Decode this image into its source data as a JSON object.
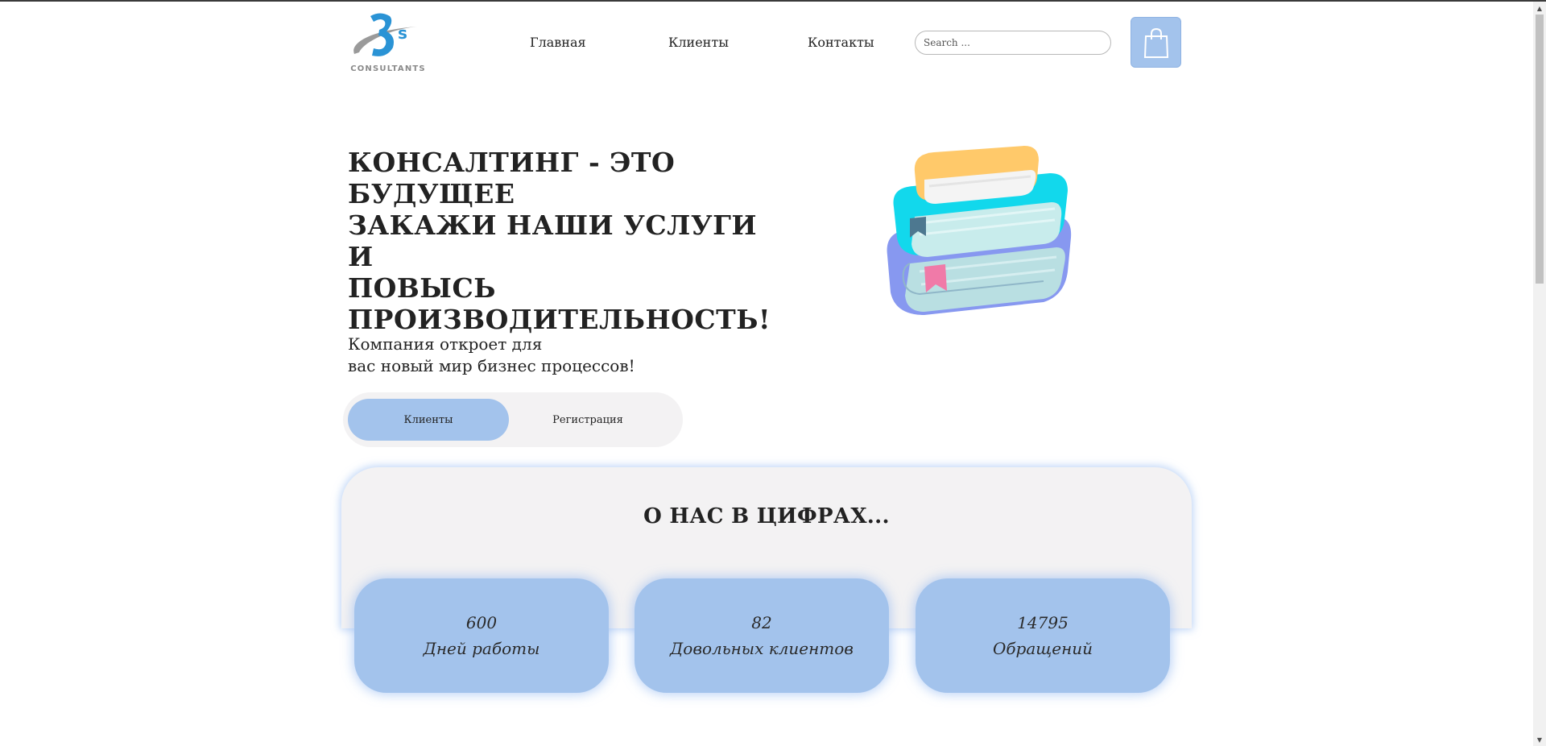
{
  "header": {
    "logo_text": "CONSULTANTS",
    "nav": [
      {
        "label": "Главная"
      },
      {
        "label": "Клиенты"
      },
      {
        "label": "Контакты"
      }
    ],
    "search_placeholder": "Search ...",
    "cart_icon": "shopping-bag-icon"
  },
  "hero": {
    "title_lines": [
      "КОНСАЛТИНГ - ЭТО",
      "БУДУЩЕЕ",
      "ЗАКАЖИ НАШИ УСЛУГИ И",
      "ПОВЫСЬ",
      "ПРОИЗВОДИТЕЛЬНОСТЬ!"
    ],
    "subtitle_lines": [
      "Компания откроет для",
      "вас новый мир бизнес процессов!"
    ],
    "toggle": {
      "active_label": "Клиенты",
      "inactive_label": "Регистрация"
    },
    "illustration": "books-stack-icon"
  },
  "stats": {
    "title": "О НАС В ЦИФРАХ...",
    "cards": [
      {
        "value": "600",
        "label": "Дней работы"
      },
      {
        "value": "82",
        "label": "Довольных клиентов"
      },
      {
        "value": "14795",
        "label": "Обращений"
      }
    ]
  },
  "colors": {
    "accent": "#a3c3ec",
    "panel": "#f3f2f3",
    "logo_blue": "#2a93d5",
    "text": "#222222"
  }
}
